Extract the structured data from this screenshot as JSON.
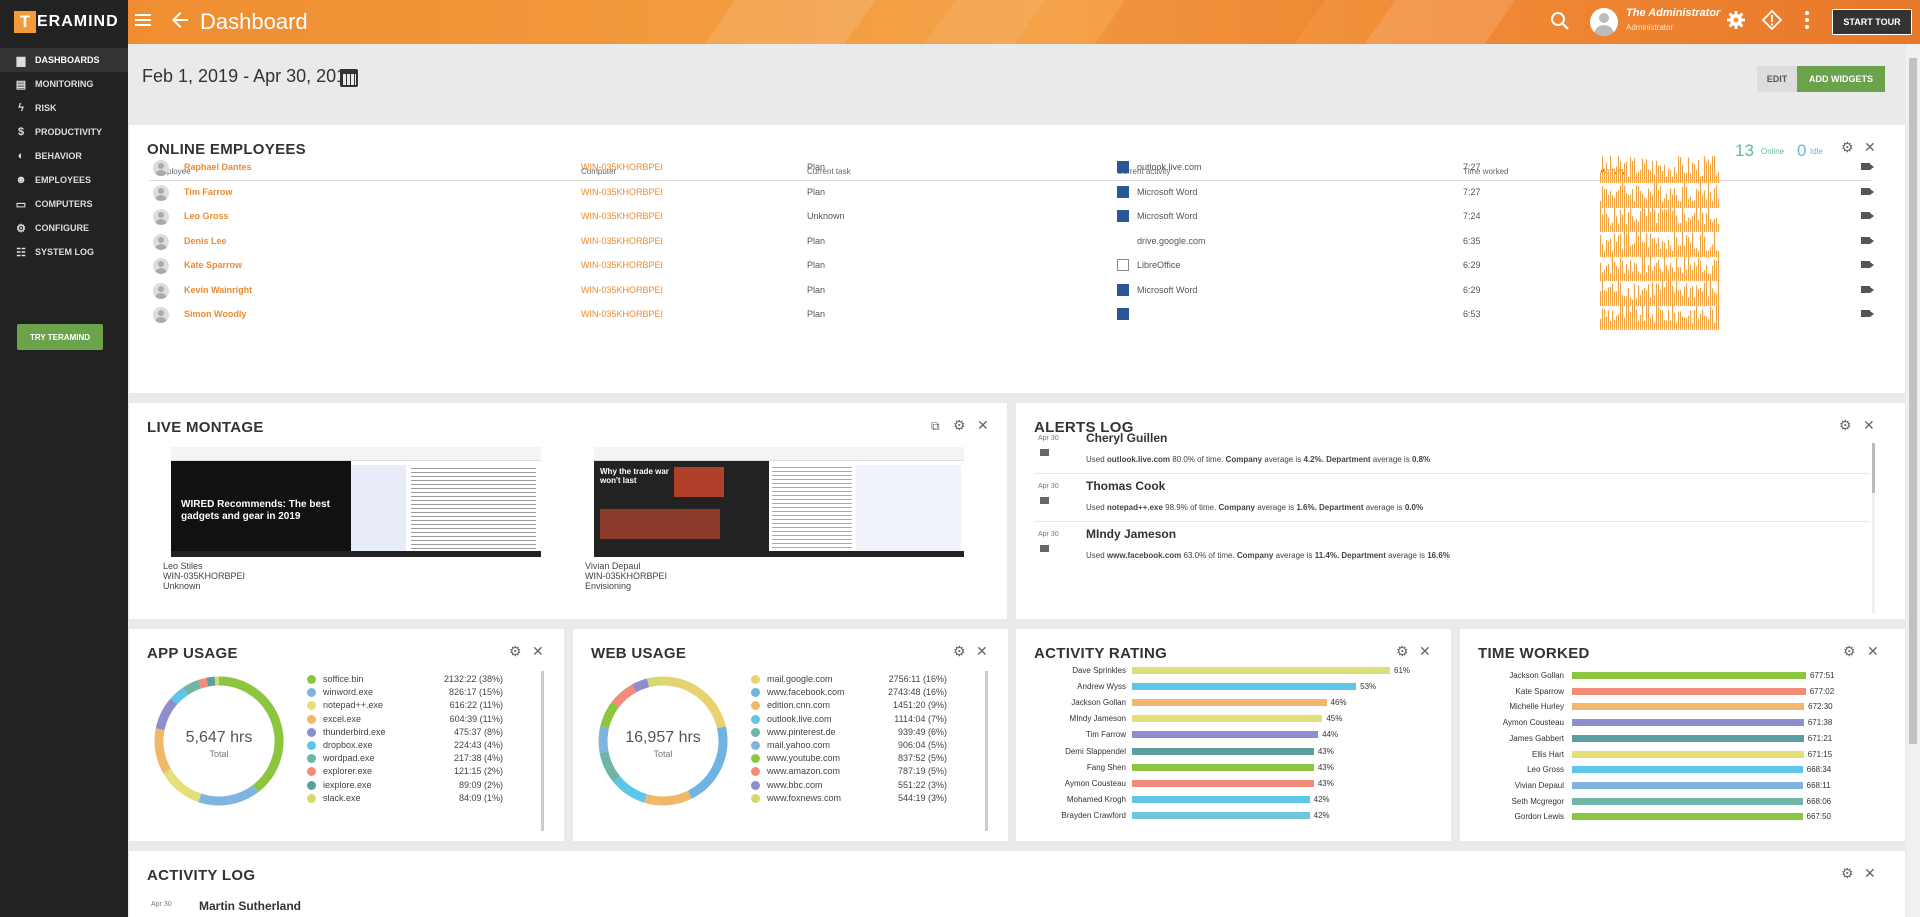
{
  "app": {
    "logo_letter": "T",
    "logo_text": "ERAMIND",
    "page_title": "Dashboard",
    "user_name": "The Administrator",
    "user_sub": "Administrator",
    "start_tour": "START TOUR"
  },
  "sidebar": {
    "items": [
      {
        "label": "DASHBOARDS",
        "icon": "dashboard-icon",
        "active": true
      },
      {
        "label": "MONITORING",
        "icon": "monitoring-icon"
      },
      {
        "label": "RISK",
        "icon": "lightning-icon"
      },
      {
        "label": "PRODUCTIVITY",
        "icon": "dollar-icon"
      },
      {
        "label": "BEHAVIOR",
        "icon": "mask-icon"
      },
      {
        "label": "EMPLOYEES",
        "icon": "users-icon"
      },
      {
        "label": "COMPUTERS",
        "icon": "monitor-icon"
      },
      {
        "label": "CONFIGURE",
        "icon": "gear-icon"
      },
      {
        "label": "SYSTEM LOG",
        "icon": "user-log-icon"
      }
    ],
    "try_label": "TRY TERAMIND"
  },
  "toolbar": {
    "date_range": "Feb 1, 2019 - Apr 30, 2019",
    "edit": "EDIT",
    "add_widgets": "ADD WIDGETS"
  },
  "online": {
    "title": "ONLINE EMPLOYEES",
    "online_count": "13",
    "online_label": "Online",
    "idle_count": "0",
    "idle_label": "Idle",
    "headers": [
      "Employee",
      "Computer",
      "Current task",
      "Current activity",
      "Time worked",
      "Activity"
    ],
    "rows": [
      {
        "name": "Raphael Dantes",
        "computer": "WIN-035KHORBPEI",
        "task": "Plan",
        "activity": "outlook.live.com",
        "icon": "outlook-icon",
        "time": "7:27"
      },
      {
        "name": "Tim Farrow",
        "computer": "WIN-035KHORBPEI",
        "task": "Plan",
        "activity": "Microsoft Word",
        "icon": "word-icon",
        "time": "7:27"
      },
      {
        "name": "Leo Gross",
        "computer": "WIN-035KHORBPEI",
        "task": "Unknown",
        "activity": "Microsoft Word",
        "icon": "word-icon",
        "time": "7:24"
      },
      {
        "name": "Denis Lee",
        "computer": "WIN-035KHORBPEI",
        "task": "Plan",
        "activity": "drive.google.com",
        "icon": "",
        "time": "6:35"
      },
      {
        "name": "Kate Sparrow",
        "computer": "WIN-035KHORBPEI",
        "task": "Plan",
        "activity": "LibreOffice",
        "icon": "libreoffice-icon",
        "time": "6:29"
      },
      {
        "name": "Kevin Wainright",
        "computer": "WIN-035KHORBPEI",
        "task": "Plan",
        "activity": "Microsoft Word",
        "icon": "word-icon",
        "time": "6:29"
      },
      {
        "name": "Simon Woodly",
        "computer": "WIN-035KHORBPEI",
        "task": "Plan",
        "activity": "",
        "icon": "word-icon",
        "time": "6:53"
      }
    ]
  },
  "montage": {
    "title": "LIVE MONTAGE",
    "items": [
      {
        "name": "Leo Stiles",
        "computer": "WIN-035KHORBPEI",
        "task": "Unknown",
        "headline": "WIRED Recommends: The best gadgets and gear in 2019"
      },
      {
        "name": "Vivian Depaul",
        "computer": "WIN-035KHORBPEI",
        "task": "Envisioning",
        "headline": "Why the trade war won't last"
      }
    ]
  },
  "alerts": {
    "title": "ALERTS LOG",
    "items": [
      {
        "date": "Apr 30",
        "name": "Cheryl Guillen",
        "pre": "Used ",
        "target": "outlook.live.com",
        "pct": " 80.0% of time. ",
        "c_label": "Company",
        "c_text": " average is ",
        "c_val": "4.2%",
        "d_label": ". Department",
        "d_text": " average is ",
        "d_val": "0.8%"
      },
      {
        "date": "Apr 30",
        "name": "Thomas Cook",
        "pre": "Used ",
        "target": "notepad++.exe",
        "pct": " 98.9% of time. ",
        "c_label": "Company",
        "c_text": " average is ",
        "c_val": "1.6%",
        "d_label": ". Department",
        "d_text": " average is ",
        "d_val": "0.0%"
      },
      {
        "date": "Apr 30",
        "name": "MIndy Jameson",
        "pre": "Used ",
        "target": "www.facebook.com",
        "pct": " 63.0% of time. ",
        "c_label": "Company",
        "c_text": " average is ",
        "c_val": "11.4%",
        "d_label": ". Department",
        "d_text": " average is ",
        "d_val": "16.6%"
      }
    ]
  },
  "app_usage": {
    "title": "APP USAGE",
    "total": "5,647 hrs",
    "total_label": "Total",
    "items": [
      {
        "label": "soffice.bin",
        "value": "2132:22 (38%)",
        "pct": 38,
        "color": "#8cc63f"
      },
      {
        "label": "winword.exe",
        "value": "826:17 (15%)",
        "pct": 15,
        "color": "#7fb3e0"
      },
      {
        "label": "notepad++.exe",
        "value": "616:22 (11%)",
        "pct": 11,
        "color": "#e3e07a"
      },
      {
        "label": "excel.exe",
        "value": "604:39 (11%)",
        "pct": 11,
        "color": "#f0b86a"
      },
      {
        "label": "thunderbird.exe",
        "value": "475:37 (8%)",
        "pct": 8,
        "color": "#8e8ecf"
      },
      {
        "label": "dropbox.exe",
        "value": "224:43 (4%)",
        "pct": 4,
        "color": "#5ec6e8"
      },
      {
        "label": "wordpad.exe",
        "value": "217:38 (4%)",
        "pct": 4,
        "color": "#70b5a8"
      },
      {
        "label": "explorer.exe",
        "value": "121:15 (2%)",
        "pct": 2,
        "color": "#f08c78"
      },
      {
        "label": "iexplore.exe",
        "value": "89:09 (2%)",
        "pct": 2,
        "color": "#5aa0a0"
      },
      {
        "label": "slack.exe",
        "value": "84:09 (1%)",
        "pct": 1,
        "color": "#d8d870"
      }
    ]
  },
  "web_usage": {
    "title": "WEB USAGE",
    "total": "16,957 hrs",
    "total_label": "Total",
    "items": [
      {
        "label": "mail.google.com",
        "value": "2756:11 (16%)",
        "pct": 16,
        "color": "#e8d270"
      },
      {
        "label": "www.facebook.com",
        "value": "2743:48 (16%)",
        "pct": 16,
        "color": "#6fb4e0"
      },
      {
        "label": "edition.cnn.com",
        "value": "1451:20 (9%)",
        "pct": 9,
        "color": "#f0b86a"
      },
      {
        "label": "outlook.live.com",
        "value": "1114:04 (7%)",
        "pct": 7,
        "color": "#5ec6e8"
      },
      {
        "label": "www.pinterest.de",
        "value": "939:49 (6%)",
        "pct": 6,
        "color": "#70b5a8"
      },
      {
        "label": "mail.yahoo.com",
        "value": "906:04 (5%)",
        "pct": 5,
        "color": "#7fb3e0"
      },
      {
        "label": "www.youtube.com",
        "value": "837:52 (5%)",
        "pct": 5,
        "color": "#8cc63f"
      },
      {
        "label": "www.amazon.com",
        "value": "787:19 (5%)",
        "pct": 5,
        "color": "#f08c78"
      },
      {
        "label": "www.bbc.com",
        "value": "551:22 (3%)",
        "pct": 3,
        "color": "#8e8ecf"
      },
      {
        "label": "www.foxnews.com",
        "value": "544:19 (3%)",
        "pct": 3,
        "color": "#d8d870"
      }
    ]
  },
  "activity_rating": {
    "title": "ACTIVITY RATING",
    "items": [
      {
        "name": "Dave Sprinkles",
        "value": 61,
        "label": "61%",
        "color": "#d9e07a"
      },
      {
        "name": "Andrew Wyss",
        "value": 53,
        "label": "53%",
        "color": "#5ec6e8"
      },
      {
        "name": "Jackson Gollan",
        "value": 46,
        "label": "46%",
        "color": "#f0b86a"
      },
      {
        "name": "MIndy Jameson",
        "value": 45,
        "label": "45%",
        "color": "#e3e07a"
      },
      {
        "name": "Tim Farrow",
        "value": 44,
        "label": "44%",
        "color": "#8e8ecf"
      },
      {
        "name": "Demi Slappendel",
        "value": 43,
        "label": "43%",
        "color": "#5aa0a0"
      },
      {
        "name": "Fang Shen",
        "value": 43,
        "label": "43%",
        "color": "#8cc63f"
      },
      {
        "name": "Aymon Cousteau",
        "value": 43,
        "label": "43%",
        "color": "#f08c78"
      },
      {
        "name": "Mohamed Krogh",
        "value": 42,
        "label": "42%",
        "color": "#5ec6e8"
      },
      {
        "name": "Brayden Crawford",
        "value": 42,
        "label": "42%",
        "color": "#6fc6d8"
      }
    ]
  },
  "time_worked": {
    "title": "TIME WORKED",
    "items": [
      {
        "name": "Jackson Gollan",
        "value": 677.85,
        "label": "677:51",
        "color": "#8cc63f"
      },
      {
        "name": "Kate Sparrow",
        "value": 677.03,
        "label": "677:02",
        "color": "#f08c78"
      },
      {
        "name": "Michelle Hurley",
        "value": 672.5,
        "label": "672:30",
        "color": "#f0b86a"
      },
      {
        "name": "Aymon Cousteau",
        "value": 671.63,
        "label": "671:38",
        "color": "#8e8ecf"
      },
      {
        "name": "James Gabbert",
        "value": 671.35,
        "label": "671:21",
        "color": "#5aa0a0"
      },
      {
        "name": "Ellis Hart",
        "value": 671.25,
        "label": "671:15",
        "color": "#e3e07a"
      },
      {
        "name": "Leo Gross",
        "value": 668.57,
        "label": "668:34",
        "color": "#5ec6e8"
      },
      {
        "name": "Vivian Depaul",
        "value": 668.18,
        "label": "668:11",
        "color": "#7fb3e0"
      },
      {
        "name": "Seth Mcgregor",
        "value": 668.1,
        "label": "668:06",
        "color": "#70b5a8"
      },
      {
        "name": "Gordon Lewis",
        "value": 667.83,
        "label": "667:50",
        "color": "#8cc63f"
      }
    ]
  },
  "activity_log": {
    "title": "ACTIVITY LOG",
    "date": "Apr 30",
    "name": "Martin Sutherland"
  },
  "colors": {
    "accent": "#ef8a2f",
    "green": "#6ba34c",
    "sidebar": "#222222",
    "online": "#5fb8a5",
    "idle": "#6fb4e0"
  }
}
